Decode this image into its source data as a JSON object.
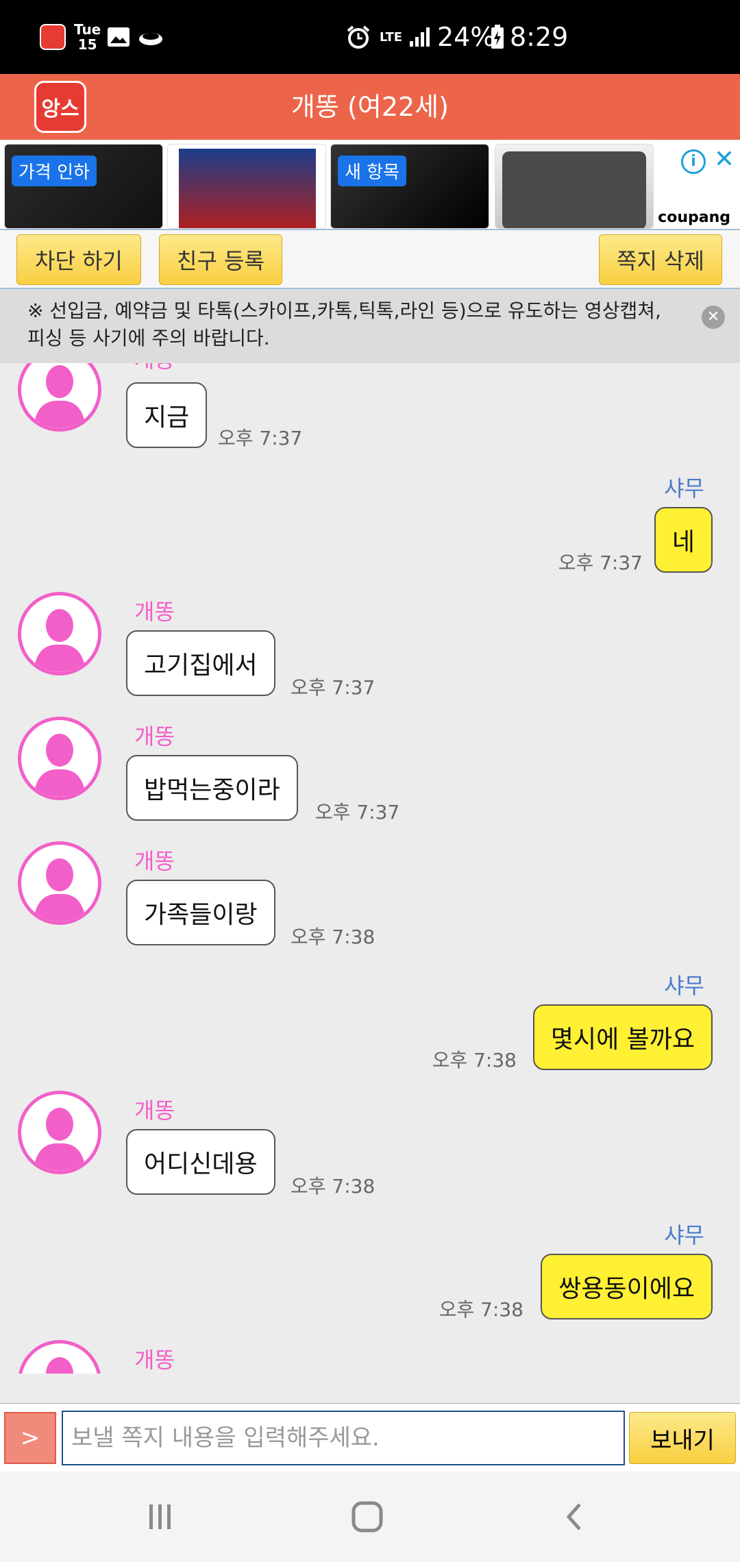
{
  "status_bar": {
    "day": "Tue",
    "date": "15",
    "network": "LTE",
    "battery": "24%",
    "time": "8:29"
  },
  "header": {
    "logo_text": "앙스",
    "title": "개똥 (여22세)"
  },
  "ad": {
    "badge1": "가격 인하",
    "badge2": "새 항목",
    "brand": "coupang"
  },
  "actions": {
    "block": "차단 하기",
    "add_friend": "친구 등록",
    "delete": "쪽지 삭제"
  },
  "notice": {
    "text": "※ 선입금, 예약금 및 타톡(스카이프,카톡,틱톡,라인 등)으로 유도하는 영상캡쳐,피싱 등 사기에 주의 바랍니다."
  },
  "messages": [
    {
      "side": "in",
      "sender": "개똥",
      "text": "지금",
      "time": "오후 7:37"
    },
    {
      "side": "out",
      "sender": "샤무",
      "text": "네",
      "time": "오후 7:37"
    },
    {
      "side": "in",
      "sender": "개똥",
      "text": "고기집에서",
      "time": "오후 7:37"
    },
    {
      "side": "in",
      "sender": "개똥",
      "text": "밥먹는중이라",
      "time": "오후 7:37"
    },
    {
      "side": "in",
      "sender": "개똥",
      "text": "가족들이랑",
      "time": "오후 7:38"
    },
    {
      "side": "out",
      "sender": "샤무",
      "text": "몇시에 볼까요",
      "time": "오후 7:38"
    },
    {
      "side": "in",
      "sender": "개똥",
      "text": "어디신데용",
      "time": "오후 7:38"
    },
    {
      "side": "out",
      "sender": "샤무",
      "text": "쌍용동이에요",
      "time": "오후 7:38"
    },
    {
      "side": "in",
      "sender": "개똥",
      "text": "",
      "time": ""
    }
  ],
  "input": {
    "plus_label": ">",
    "placeholder": "보낼 쪽지 내용을 입력해주세요.",
    "send_label": "보내기"
  },
  "colors": {
    "header": "#ec654a",
    "female_name": "#f25fc8",
    "male_name": "#4b7bcc",
    "out_bubble": "#fff033",
    "button_yellow": "#f9cf41"
  }
}
